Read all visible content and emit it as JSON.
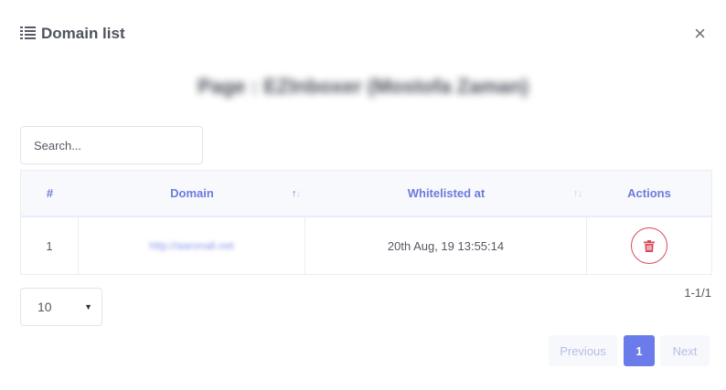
{
  "header": {
    "title": "Domain list",
    "icon": "list-icon",
    "close_icon": "close-icon",
    "close_glyph": "×"
  },
  "subtitle": "Page : EZInboxer (Mostofa Zaman)",
  "search": {
    "placeholder": "Search...",
    "value": ""
  },
  "table": {
    "columns": [
      {
        "label": "#",
        "sortable": false
      },
      {
        "label": "Domain",
        "sortable": true,
        "sort_state": "ascending"
      },
      {
        "label": "Whitelisted at",
        "sortable": true,
        "sort_state": "none"
      },
      {
        "label": "Actions",
        "sortable": false
      }
    ],
    "rows": [
      {
        "index": "1",
        "domain": "http://aaronali.net",
        "whitelisted_at": "20th Aug, 19 13:55:14",
        "action_icon": "trash-icon"
      }
    ]
  },
  "per_page": {
    "selected": "10"
  },
  "range_info": "1-1/1",
  "pagination": {
    "previous": "Previous",
    "current": "1",
    "next": "Next"
  },
  "colors": {
    "accent": "#6c7bea",
    "header_text": "#6c7bdc",
    "danger": "#d84a5b",
    "link": "#8d98e8"
  }
}
